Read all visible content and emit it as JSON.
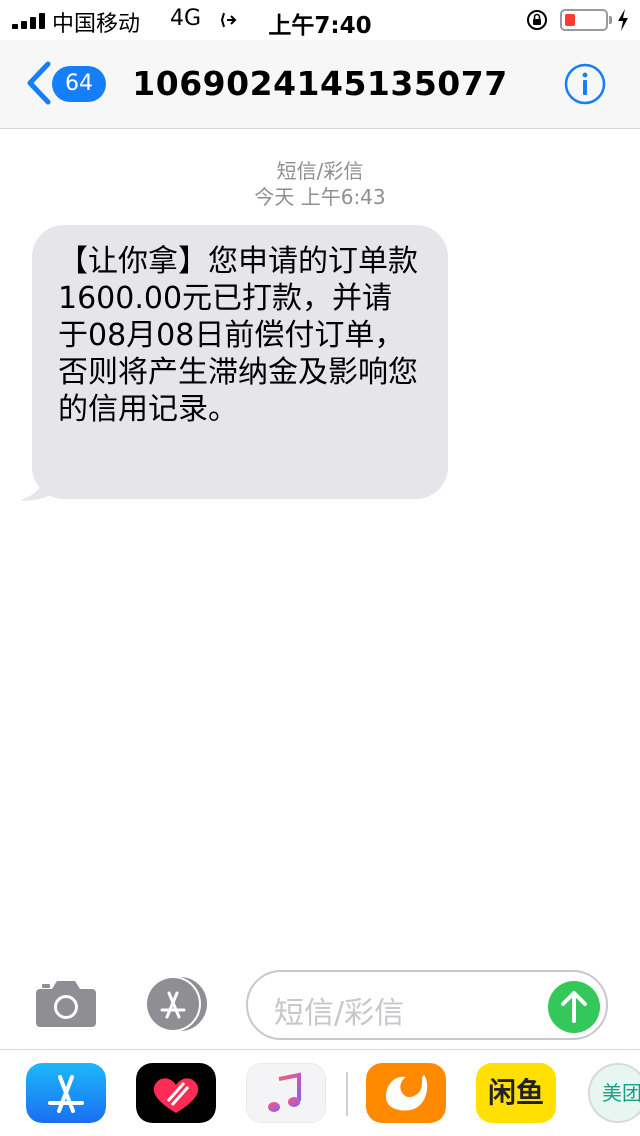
{
  "status_bar": {
    "carrier": "中国移动",
    "network": "4G",
    "time": "上午7:40",
    "icons": [
      "signal-icon",
      "location-arrow-icon",
      "rotation-lock-icon",
      "battery-low-icon",
      "charging-bolt-icon"
    ]
  },
  "nav": {
    "unread_count": "64",
    "title": "1069024145135077",
    "icons": [
      "back-chevron-icon",
      "info-icon"
    ]
  },
  "thread": {
    "message_type": "短信/彩信",
    "timestamp": "今天 上午6:43",
    "message": "【让你拿】您申请的订单款1600.00元已打款，并请于08月08日前偿付订单，否则将产生滞纳金及影响您的信用记录。"
  },
  "composer": {
    "placeholder": "短信/彩信",
    "icons": [
      "camera-icon",
      "app-store-icon",
      "send-arrow-icon"
    ]
  },
  "app_drawer": {
    "apps": [
      {
        "name": "app-store-icon"
      },
      {
        "name": "digital-touch-icon"
      },
      {
        "name": "music-icon"
      },
      {
        "name": "uc-browser-icon"
      },
      {
        "name": "xianyu-icon",
        "label": "闲鱼"
      },
      {
        "name": "meituan-icon",
        "label": "美团"
      }
    ]
  },
  "colors": {
    "accent": "#147efb",
    "bubble": "#e5e5ea",
    "send": "#34c759",
    "battery": "#ff3b30"
  }
}
